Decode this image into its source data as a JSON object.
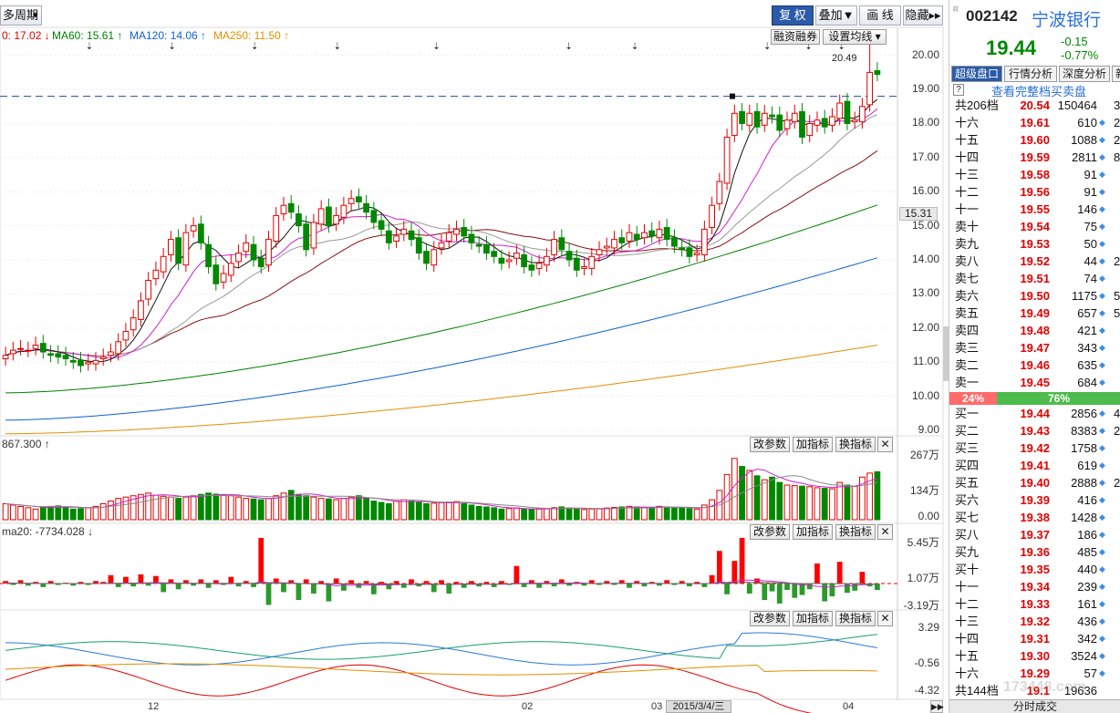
{
  "toolbar": {
    "period": "多周期",
    "fq": "复 权",
    "overlay": "叠加▼",
    "draw": "画 线",
    "hide": "隐藏▸▸"
  },
  "ma_legend": [
    {
      "text": "0: 17.02 ↓",
      "color": "#e00000"
    },
    {
      "text": "MA60: 15.61 ↑",
      "color": "#008000"
    },
    {
      "text": "MA120: 14.06 ↑",
      "color": "#1060d0"
    },
    {
      "text": "MA250: 11.50 ↑",
      "color": "#e09000"
    }
  ],
  "main_buttons": {
    "margin": "融资融券",
    "ma_setting": "设置均线 ▾"
  },
  "high_label": "20.49",
  "price_axis": [
    "20.00",
    "19.00",
    "18.00",
    "17.00",
    "16.00",
    "15.00",
    "14.00",
    "13.00",
    "12.00",
    "11.00",
    "10.00",
    "9.00"
  ],
  "current_price_tag": "15.31",
  "vol_panel": {
    "legend": "867.300 ↑",
    "axis": [
      "267万",
      "134万",
      "0.00"
    ]
  },
  "panel_buttons": {
    "params": "改参数",
    "add": "加指标",
    "switch": "换指标",
    "close": "✕"
  },
  "flow_panel": {
    "legend": "ma20: -7734.028 ↓",
    "axis": [
      "5.45万",
      "1.07万",
      "-3.19万"
    ]
  },
  "ind_panel": {
    "axis": [
      "3.29",
      "-0.56",
      "-4.32"
    ]
  },
  "x_labels": [
    "12",
    "02",
    "03",
    "04"
  ],
  "date_tip": "2015/3/4/三",
  "watermark": "173448.com",
  "colors": {
    "up": "#e00000",
    "down": "#008800",
    "ma5": "#111111",
    "ma10": "#d020d0",
    "ma20": "#999999",
    "ma30": "#8a1010",
    "ma60": "#008000",
    "ma120": "#1060d0",
    "ma250": "#e09000",
    "accent": "#2a5aa8"
  },
  "stock": {
    "code": "002142",
    "name": "宁波银行",
    "price": "19.44",
    "change": "-0.15",
    "pct": "-0.77%"
  },
  "tabs": [
    "超级盘口",
    "行情分析",
    "深度分析",
    "新"
  ],
  "full_book_link": "查看完整档买卖盘",
  "total_sell": {
    "label": "共206档",
    "price": "20.54",
    "vol": "150464",
    "extra": "3"
  },
  "sell_levels": [
    {
      "lv": "十六",
      "p": "19.61",
      "v": "610",
      "e": "2"
    },
    {
      "lv": "十五",
      "p": "19.60",
      "v": "1088",
      "e": "2"
    },
    {
      "lv": "十四",
      "p": "19.59",
      "v": "2811",
      "e": "8"
    },
    {
      "lv": "十三",
      "p": "19.58",
      "v": "91",
      "e": ""
    },
    {
      "lv": "十二",
      "p": "19.56",
      "v": "91",
      "e": ""
    },
    {
      "lv": "十一",
      "p": "19.55",
      "v": "146",
      "e": ""
    },
    {
      "lv": "卖十",
      "p": "19.54",
      "v": "75",
      "e": ""
    },
    {
      "lv": "卖九",
      "p": "19.53",
      "v": "50",
      "e": ""
    },
    {
      "lv": "卖八",
      "p": "19.52",
      "v": "44",
      "e": "2"
    },
    {
      "lv": "卖七",
      "p": "19.51",
      "v": "74",
      "e": ""
    },
    {
      "lv": "卖六",
      "p": "19.50",
      "v": "1175",
      "e": "5"
    },
    {
      "lv": "卖五",
      "p": "19.49",
      "v": "657",
      "e": "5"
    },
    {
      "lv": "卖四",
      "p": "19.48",
      "v": "421",
      "e": ""
    },
    {
      "lv": "卖三",
      "p": "19.47",
      "v": "343",
      "e": ""
    },
    {
      "lv": "卖二",
      "p": "19.46",
      "v": "635",
      "e": ""
    },
    {
      "lv": "卖一",
      "p": "19.45",
      "v": "684",
      "e": ""
    }
  ],
  "ratio": {
    "sell": "24%",
    "buy": "76%"
  },
  "buy_levels": [
    {
      "lv": "买一",
      "p": "19.44",
      "v": "2856",
      "e": "4"
    },
    {
      "lv": "买二",
      "p": "19.43",
      "v": "8383",
      "e": "2"
    },
    {
      "lv": "买三",
      "p": "19.42",
      "v": "1758",
      "e": ""
    },
    {
      "lv": "买四",
      "p": "19.41",
      "v": "619",
      "e": ""
    },
    {
      "lv": "买五",
      "p": "19.40",
      "v": "2888",
      "e": "2"
    },
    {
      "lv": "买六",
      "p": "19.39",
      "v": "416",
      "e": ""
    },
    {
      "lv": "买七",
      "p": "19.38",
      "v": "1428",
      "e": ""
    },
    {
      "lv": "买八",
      "p": "19.37",
      "v": "186",
      "e": ""
    },
    {
      "lv": "买九",
      "p": "19.36",
      "v": "485",
      "e": ""
    },
    {
      "lv": "买十",
      "p": "19.35",
      "v": "440",
      "e": ""
    },
    {
      "lv": "十一",
      "p": "19.34",
      "v": "239",
      "e": ""
    },
    {
      "lv": "十二",
      "p": "19.33",
      "v": "161",
      "e": ""
    },
    {
      "lv": "十三",
      "p": "19.32",
      "v": "436",
      "e": ""
    },
    {
      "lv": "十四",
      "p": "19.31",
      "v": "342",
      "e": ""
    },
    {
      "lv": "十五",
      "p": "19.30",
      "v": "3524",
      "e": ""
    },
    {
      "lv": "十六",
      "p": "19.29",
      "v": "57",
      "e": ""
    }
  ],
  "total_buy": {
    "label": "共144档",
    "price": "19.1",
    "vol": "19636",
    "extra": ""
  },
  "bottom_tab": "分时成交",
  "chart_data": {
    "type": "candlestick",
    "ma_lines": [
      "MA60",
      "MA120",
      "MA250"
    ],
    "y_range": [
      9,
      20.5
    ],
    "reference_line": 18.8,
    "last_close": 19.44,
    "high": 20.49,
    "closes": [
      11.2,
      11.35,
      11.4,
      11.35,
      11.5,
      11.3,
      11.2,
      11.15,
      11.1,
      11.0,
      10.9,
      11.0,
      11.05,
      11.15,
      11.3,
      11.6,
      11.9,
      12.3,
      12.8,
      13.4,
      13.7,
      14.1,
      14.6,
      13.9,
      14.8,
      15.0,
      14.5,
      13.8,
      13.3,
      13.6,
      13.9,
      14.2,
      14.5,
      14.0,
      13.8,
      14.6,
      15.3,
      15.6,
      15.4,
      15.0,
      14.3,
      15.1,
      15.5,
      15.0,
      15.3,
      15.6,
      15.8,
      15.7,
      15.4,
      15.1,
      14.9,
      14.5,
      14.7,
      14.9,
      14.6,
      14.2,
      13.9,
      14.3,
      14.5,
      14.8,
      14.9,
      14.7,
      14.5,
      14.4,
      14.2,
      14.1,
      13.9,
      14.0,
      14.2,
      13.8,
      13.7,
      13.9,
      14.1,
      14.6,
      14.3,
      14.0,
      13.7,
      13.8,
      14.1,
      14.3,
      14.4,
      14.6,
      14.5,
      14.8,
      14.6,
      14.8,
      14.7,
      14.9,
      14.6,
      14.4,
      14.3,
      14.1,
      14.2,
      14.9,
      15.6,
      16.3,
      17.6,
      18.3,
      18.0,
      18.3,
      17.9,
      18.3,
      18.2,
      17.8,
      18.1,
      18.3,
      17.6,
      18.0,
      18.1,
      17.9,
      18.2,
      18.6,
      18.0,
      18.1,
      18.5,
      19.5,
      19.44
    ],
    "volumes": [
      60,
      55,
      50,
      45,
      40,
      45,
      50,
      52,
      48,
      40,
      42,
      45,
      50,
      60,
      70,
      80,
      85,
      90,
      95,
      100,
      92,
      88,
      85,
      80,
      85,
      90,
      95,
      100,
      96,
      92,
      90,
      85,
      80,
      78,
      75,
      80,
      90,
      100,
      110,
      95,
      90,
      85,
      80,
      78,
      75,
      80,
      85,
      90,
      80,
      70,
      65,
      60,
      70,
      75,
      70,
      65,
      60,
      62,
      64,
      66,
      68,
      60,
      55,
      50,
      48,
      45,
      40,
      42,
      44,
      40,
      38,
      40,
      42,
      45,
      48,
      44,
      40,
      38,
      40,
      42,
      44,
      46,
      48,
      50,
      48,
      46,
      44,
      50,
      48,
      46,
      44,
      42,
      40,
      55,
      75,
      110,
      170,
      230,
      200,
      185,
      165,
      150,
      160,
      140,
      130,
      128,
      126,
      124,
      120,
      118,
      116,
      140,
      130,
      125,
      160,
      175,
      180
    ],
    "flow": [
      0.3,
      -0.2,
      0.4,
      -0.3,
      0.2,
      -0.5,
      0.3,
      -0.2,
      0.1,
      -0.3,
      0.2,
      -0.2,
      0.3,
      0.2,
      1.0,
      -0.5,
      0.8,
      -0.4,
      1.1,
      -0.3,
      0.9,
      -1.2,
      0.5,
      -0.8,
      0.4,
      -0.3,
      0.5,
      -0.6,
      0.4,
      -0.2,
      0.8,
      -0.4,
      0.3,
      -0.5,
      5.45,
      -3.0,
      0.6,
      -1.2,
      0.4,
      -2.3,
      0.5,
      -1.4,
      0.3,
      -2.5,
      0.6,
      -1.0,
      0.4,
      -0.6,
      0.3,
      -1.5,
      0.2,
      -0.8,
      0.3,
      -0.6,
      0.5,
      -0.4,
      0.3,
      -1.2,
      0.4,
      -1.4,
      0.2,
      -0.6,
      0.3,
      -0.4,
      0.2,
      -0.5,
      0.3,
      -0.2,
      2.1,
      -0.5,
      0.4,
      -0.6,
      0.3,
      -0.4,
      0.5,
      -0.3,
      0.2,
      -0.3,
      0.4,
      -0.2,
      0.3,
      -0.2,
      0.4,
      -0.6,
      0.3,
      -0.4,
      0.2,
      -0.3,
      0.4,
      -0.2,
      0.3,
      -0.4,
      0.2,
      -0.5,
      1.0,
      3.9,
      -1.5,
      2.7,
      5.45,
      -1.4,
      0.6,
      -2.3,
      -1.1,
      -2.8,
      -0.9,
      -2.0,
      -1.6,
      -0.8,
      2.4,
      -2.5,
      -1.8,
      2.6,
      -1.3,
      -1.0,
      1.4,
      -0.4,
      -0.9
    ]
  }
}
